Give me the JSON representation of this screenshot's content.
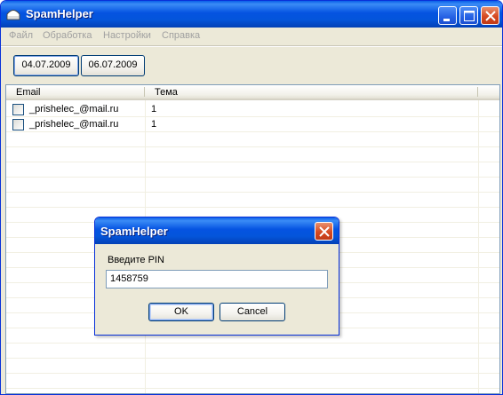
{
  "window": {
    "title": "SpamHelper",
    "accent_color": "#0554E0"
  },
  "menu": {
    "items": [
      "Файл",
      "Обработка",
      "Настройки",
      "Справка"
    ]
  },
  "toolbar": {
    "date_buttons": [
      "04.07.2009",
      "06.07.2009"
    ]
  },
  "list": {
    "columns": [
      "Email",
      "Тема"
    ],
    "rows": [
      {
        "checked": false,
        "email": "_prishelec_@mail.ru",
        "subject": "1"
      },
      {
        "checked": false,
        "email": "_prishelec_@mail.ru",
        "subject": "1"
      }
    ]
  },
  "dialog": {
    "title": "SpamHelper",
    "label": "Введите PIN",
    "input_value": "1458759",
    "ok_label": "OK",
    "cancel_label": "Cancel"
  },
  "icons": {
    "app": "app-icon",
    "minimize": "minimize-icon",
    "maximize": "maximize-icon",
    "close": "close-icon"
  }
}
